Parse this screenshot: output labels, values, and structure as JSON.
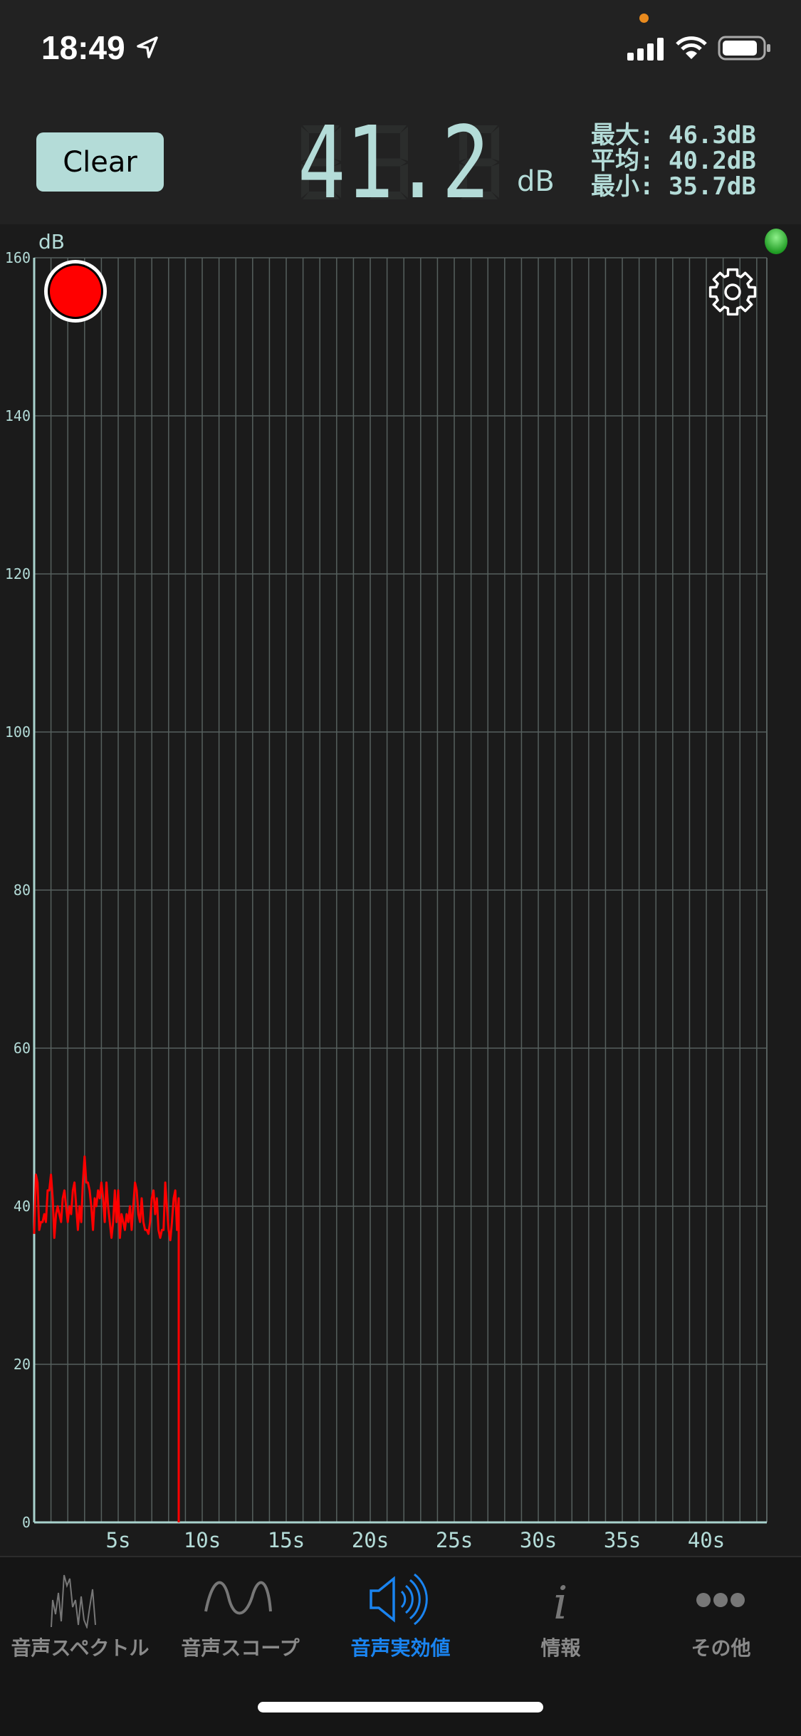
{
  "status_bar": {
    "time": "18:49",
    "icons": [
      "location-arrow-icon",
      "privacy-dot-icon",
      "cellular-signal-icon",
      "wifi-icon",
      "battery-icon"
    ]
  },
  "header": {
    "clear_label": "Clear",
    "current_value": "41.2",
    "current_unit": "dB",
    "stats": [
      {
        "label": "最大:",
        "value": "46.3dB"
      },
      {
        "label": "平均:",
        "value": "40.2dB"
      },
      {
        "label": "最小:",
        "value": "35.7dB"
      }
    ]
  },
  "colors": {
    "accent": "#1a84f0",
    "lcd": "#b4dcd8",
    "lcd_dim": "#2b2d2c",
    "series": "#ff0000",
    "record": "#ff0000",
    "indicator": "#3ec43e",
    "grid": "#56605e",
    "axis": "#a8d2cd"
  },
  "chart_data": {
    "type": "line",
    "ylabel": "dB",
    "ylim": [
      0,
      160
    ],
    "xlim": [
      0,
      43.6
    ],
    "yticks": [
      "0",
      "20",
      "40",
      "60",
      "80",
      "100",
      "120",
      "140",
      "160"
    ],
    "xticks": [
      {
        "v": 5,
        "label": "5s"
      },
      {
        "v": 10,
        "label": "10s"
      },
      {
        "v": 15,
        "label": "15s"
      },
      {
        "v": 20,
        "label": "20s"
      },
      {
        "v": 25,
        "label": "25s"
      },
      {
        "v": 30,
        "label": "30s"
      },
      {
        "v": 35,
        "label": "35s"
      },
      {
        "v": 40,
        "label": "40s"
      }
    ],
    "grid": true,
    "x_grid_step_s": 1,
    "series": [
      {
        "points": [
          [
            0.0,
            36.5
          ],
          [
            0.1,
            44
          ],
          [
            0.2,
            43
          ],
          [
            0.3,
            37
          ],
          [
            0.4,
            38
          ],
          [
            0.5,
            38
          ],
          [
            0.6,
            39
          ],
          [
            0.7,
            38
          ],
          [
            0.8,
            42
          ],
          [
            0.9,
            42
          ],
          [
            1.0,
            44
          ],
          [
            1.1,
            41
          ],
          [
            1.2,
            36
          ],
          [
            1.3,
            39
          ],
          [
            1.4,
            40
          ],
          [
            1.5,
            39
          ],
          [
            1.6,
            38
          ],
          [
            1.7,
            41
          ],
          [
            1.8,
            42
          ],
          [
            1.9,
            40
          ],
          [
            2.0,
            38
          ],
          [
            2.1,
            40
          ],
          [
            2.2,
            39
          ],
          [
            2.3,
            42
          ],
          [
            2.4,
            43
          ],
          [
            2.5,
            40
          ],
          [
            2.6,
            37
          ],
          [
            2.7,
            40
          ],
          [
            2.8,
            38
          ],
          [
            2.9,
            43
          ],
          [
            3.0,
            46.3
          ],
          [
            3.1,
            43
          ],
          [
            3.2,
            43
          ],
          [
            3.3,
            42
          ],
          [
            3.4,
            40
          ],
          [
            3.5,
            37
          ],
          [
            3.6,
            41
          ],
          [
            3.7,
            40
          ],
          [
            3.8,
            42
          ],
          [
            3.9,
            41
          ],
          [
            4.0,
            43
          ],
          [
            4.1,
            41
          ],
          [
            4.2,
            38
          ],
          [
            4.3,
            43
          ],
          [
            4.4,
            40
          ],
          [
            4.5,
            38
          ],
          [
            4.6,
            36
          ],
          [
            4.7,
            38
          ],
          [
            4.8,
            42
          ],
          [
            4.9,
            38
          ],
          [
            5.0,
            42
          ],
          [
            5.1,
            36
          ],
          [
            5.2,
            39
          ],
          [
            5.3,
            38
          ],
          [
            5.4,
            37
          ],
          [
            5.5,
            39
          ],
          [
            5.6,
            38
          ],
          [
            5.7,
            40
          ],
          [
            5.8,
            37
          ],
          [
            5.9,
            40
          ],
          [
            6.0,
            43
          ],
          [
            6.1,
            42
          ],
          [
            6.2,
            39
          ],
          [
            6.3,
            38
          ],
          [
            6.4,
            41
          ],
          [
            6.5,
            38
          ],
          [
            6.6,
            37
          ],
          [
            6.7,
            37
          ],
          [
            6.8,
            36.5
          ],
          [
            6.9,
            38
          ],
          [
            7.0,
            41
          ],
          [
            7.1,
            42
          ],
          [
            7.2,
            39
          ],
          [
            7.3,
            41
          ],
          [
            7.4,
            37
          ],
          [
            7.5,
            36
          ],
          [
            7.6,
            37
          ],
          [
            7.7,
            37
          ],
          [
            7.8,
            43
          ],
          [
            7.9,
            40
          ],
          [
            8.0,
            37
          ],
          [
            8.1,
            35.7
          ],
          [
            8.2,
            38
          ],
          [
            8.3,
            41
          ],
          [
            8.4,
            42
          ],
          [
            8.5,
            37
          ],
          [
            8.6,
            41
          ],
          [
            8.6,
            0
          ]
        ]
      }
    ]
  },
  "tabs": [
    {
      "label": "音声スペクトル",
      "icon": "spectrum-icon",
      "active": false
    },
    {
      "label": "音声スコープ",
      "icon": "sine-wave-icon",
      "active": false
    },
    {
      "label": "音声実効値",
      "icon": "speaker-icon",
      "active": true
    },
    {
      "label": "情報",
      "icon": "info-icon",
      "active": false
    },
    {
      "label": "その他",
      "icon": "more-icon",
      "active": false
    }
  ]
}
